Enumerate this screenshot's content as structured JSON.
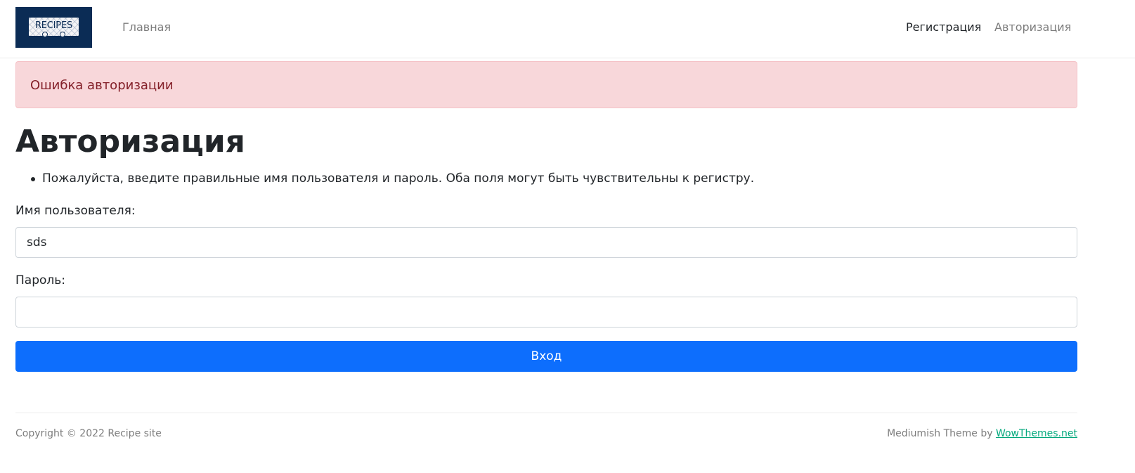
{
  "navbar": {
    "logo_text": "RECIPES",
    "links": {
      "home": "Главная",
      "register": "Регистрация",
      "login": "Авторизация"
    }
  },
  "alert": {
    "message": "Ошибка авторизации"
  },
  "page": {
    "title": "Авторизация",
    "errors": [
      "Пожалуйста, введите правильные имя пользователя и пароль. Оба поля могут быть чувствительны к регистру."
    ]
  },
  "form": {
    "username_label": "Имя пользователя:",
    "username_value": "sds",
    "password_label": "Пароль:",
    "password_value": "",
    "submit_label": "Вход"
  },
  "footer": {
    "copyright": "Copyright © 2022 Recipe site",
    "theme_prefix": "Mediumish Theme by ",
    "theme_link": "WowThemes.net"
  },
  "colors": {
    "primary": "#0d6efd",
    "alert_bg": "#f8d7da",
    "alert_text": "#842029",
    "logo_bg": "#0b2c55",
    "footer_link": "#03a87c"
  }
}
